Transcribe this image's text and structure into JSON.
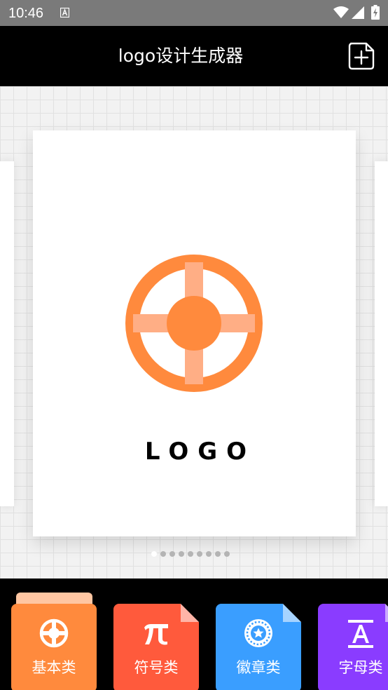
{
  "status_bar": {
    "time": "10:46",
    "icons": [
      "a-notification-icon",
      "wifi-icon",
      "signal-icon",
      "battery-charging-icon"
    ]
  },
  "header": {
    "title": "logo设计生成器",
    "action_icon": "new-file-icon"
  },
  "canvas": {
    "template": {
      "logo_text": "LOGO",
      "logo_icon": "lifebuoy-icon",
      "colors": {
        "ring": "#ff8a3d",
        "spokes": "#ffae85",
        "center": "#ff8a3d",
        "text": "#000000"
      }
    },
    "pager": {
      "count": 9,
      "active_index": 0
    }
  },
  "categories": [
    {
      "label": "基本类",
      "icon": "lifebuoy-icon",
      "color": "#ff8a3d",
      "selected": true
    },
    {
      "label": "符号类",
      "icon": "pi-icon",
      "color": "#ff5a3c",
      "selected": false
    },
    {
      "label": "徽章类",
      "icon": "badge-icon",
      "color": "#3a9eff",
      "selected": false
    },
    {
      "label": "字母类",
      "icon": "letter-a-icon",
      "color": "#8a3cff",
      "selected": false
    }
  ]
}
